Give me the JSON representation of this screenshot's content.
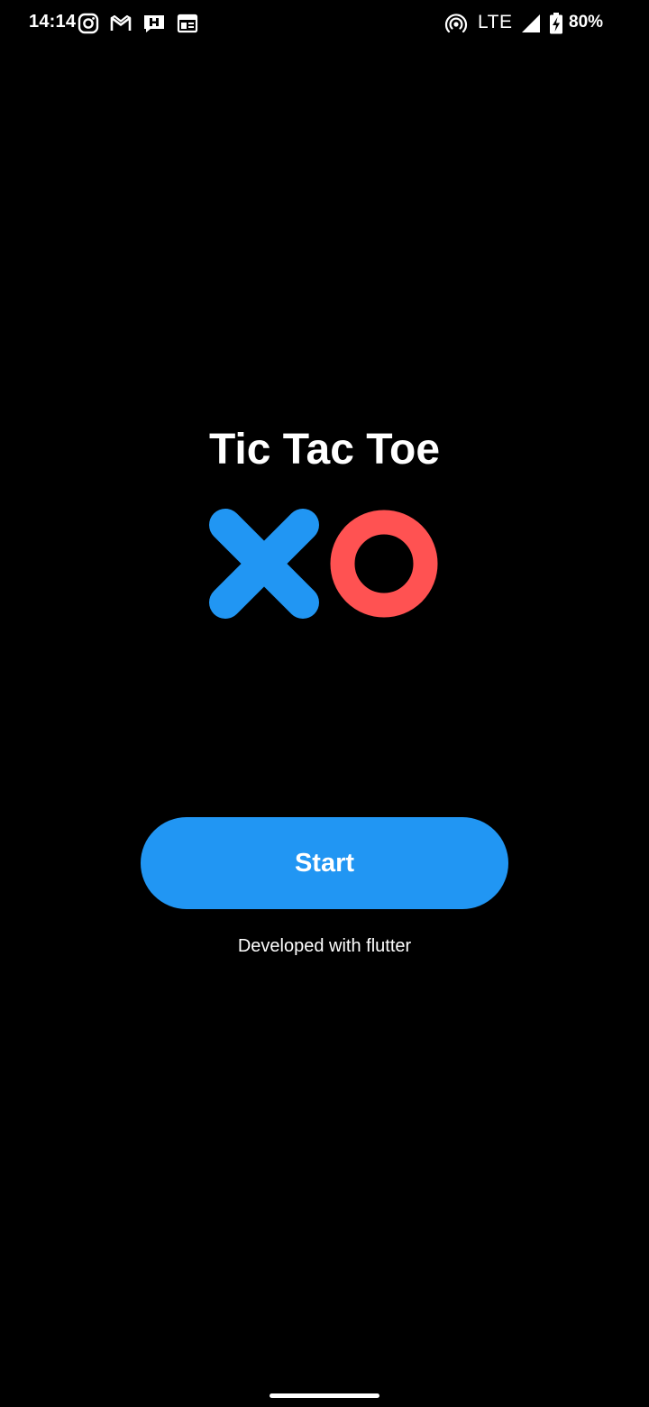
{
  "status_bar": {
    "time": "14:14",
    "network": "LTE",
    "battery": "80%",
    "left_icons": [
      "instagram-icon",
      "gmail-icon",
      "chat-icon",
      "calendar-icon"
    ],
    "right_icons": [
      "hotspot-icon",
      "signal-icon",
      "battery-charging-icon"
    ]
  },
  "app": {
    "title": "Tic Tac Toe",
    "start_label": "Start",
    "footer": "Developed with flutter"
  },
  "colors": {
    "background": "#000000",
    "accent_blue": "#2196F3",
    "o_red": "#FF5252",
    "text": "#FFFFFF"
  }
}
